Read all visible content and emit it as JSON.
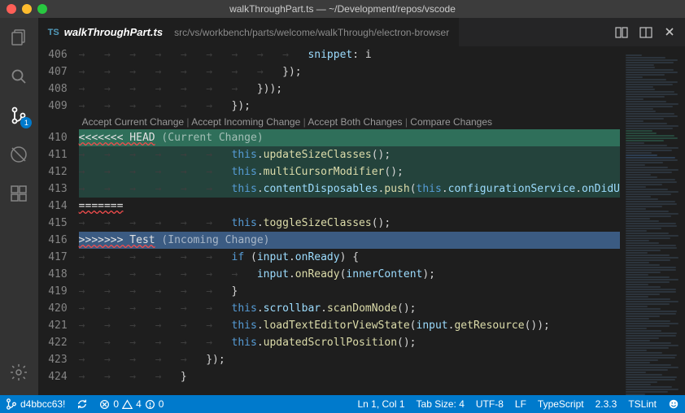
{
  "window": {
    "title": "walkThroughPart.ts — ~/Development/repos/vscode"
  },
  "tab": {
    "icon": "TS",
    "name": "walkThroughPart.ts",
    "breadcrumb": "src/vs/workbench/parts/welcome/walkThrough/electron-browser"
  },
  "scm_badge": "1",
  "codelens": {
    "accept_current": "Accept Current Change",
    "accept_incoming": "Accept Incoming Change",
    "accept_both": "Accept Both Changes",
    "compare": "Compare Changes",
    "sep": " | "
  },
  "lines": [
    {
      "n": "406",
      "kind": "plain",
      "indent": 9,
      "tokens": [
        [
          "prop",
          "snippet"
        ],
        [
          "punc",
          ": i"
        ]
      ]
    },
    {
      "n": "407",
      "kind": "plain",
      "indent": 8,
      "tokens": [
        [
          "punc",
          "});"
        ]
      ]
    },
    {
      "n": "408",
      "kind": "plain",
      "indent": 7,
      "tokens": [
        [
          "punc",
          "}));"
        ]
      ]
    },
    {
      "n": "409",
      "kind": "plain",
      "indent": 6,
      "tokens": [
        [
          "punc",
          "});"
        ]
      ]
    },
    {
      "n": "410",
      "kind": "current",
      "indent": 0,
      "tokens": [
        [
          "conflict",
          "<<<<<<< HEAD"
        ],
        [
          "hint",
          " (Current Change)"
        ]
      ]
    },
    {
      "n": "411",
      "kind": "current-body",
      "indent": 6,
      "tokens": [
        [
          "this",
          "this"
        ],
        [
          "punc",
          "."
        ],
        [
          "fn",
          "updateSizeClasses"
        ],
        [
          "punc",
          "();"
        ]
      ]
    },
    {
      "n": "412",
      "kind": "current-body",
      "indent": 6,
      "tokens": [
        [
          "this",
          "this"
        ],
        [
          "punc",
          "."
        ],
        [
          "fn",
          "multiCursorModifier"
        ],
        [
          "punc",
          "();"
        ]
      ]
    },
    {
      "n": "413",
      "kind": "current-body",
      "indent": 6,
      "tokens": [
        [
          "this",
          "this"
        ],
        [
          "punc",
          "."
        ],
        [
          "prop",
          "contentDisposables"
        ],
        [
          "punc",
          "."
        ],
        [
          "fn",
          "push"
        ],
        [
          "punc",
          "("
        ],
        [
          "this",
          "this"
        ],
        [
          "punc",
          "."
        ],
        [
          "prop",
          "configurationService"
        ],
        [
          "punc",
          "."
        ],
        [
          "prop",
          "onDidU"
        ]
      ]
    },
    {
      "n": "414",
      "kind": "sep",
      "indent": 0,
      "tokens": [
        [
          "conflict",
          "======="
        ]
      ]
    },
    {
      "n": "415",
      "kind": "plain",
      "indent": 6,
      "tokens": [
        [
          "this",
          "this"
        ],
        [
          "punc",
          "."
        ],
        [
          "fn",
          "toggleSizeClasses"
        ],
        [
          "punc",
          "();"
        ]
      ]
    },
    {
      "n": "416",
      "kind": "incoming",
      "indent": 0,
      "tokens": [
        [
          "conflict",
          ">>>>>>> Test"
        ],
        [
          "hint",
          " (Incoming Change)"
        ]
      ]
    },
    {
      "n": "417",
      "kind": "plain",
      "indent": 6,
      "tokens": [
        [
          "kw",
          "if"
        ],
        [
          "punc",
          " ("
        ],
        [
          "prop",
          "input"
        ],
        [
          "punc",
          "."
        ],
        [
          "prop",
          "onReady"
        ],
        [
          "punc",
          ") {"
        ]
      ]
    },
    {
      "n": "418",
      "kind": "plain",
      "indent": 7,
      "tokens": [
        [
          "prop",
          "input"
        ],
        [
          "punc",
          "."
        ],
        [
          "fn",
          "onReady"
        ],
        [
          "punc",
          "("
        ],
        [
          "param",
          "innerContent"
        ],
        [
          "punc",
          ");"
        ]
      ]
    },
    {
      "n": "419",
      "kind": "plain",
      "indent": 6,
      "tokens": [
        [
          "punc",
          "}"
        ]
      ]
    },
    {
      "n": "420",
      "kind": "plain",
      "indent": 6,
      "tokens": [
        [
          "this",
          "this"
        ],
        [
          "punc",
          "."
        ],
        [
          "prop",
          "scrollbar"
        ],
        [
          "punc",
          "."
        ],
        [
          "fn",
          "scanDomNode"
        ],
        [
          "punc",
          "();"
        ]
      ]
    },
    {
      "n": "421",
      "kind": "plain",
      "indent": 6,
      "tokens": [
        [
          "this",
          "this"
        ],
        [
          "punc",
          "."
        ],
        [
          "fn",
          "loadTextEditorViewState"
        ],
        [
          "punc",
          "("
        ],
        [
          "prop",
          "input"
        ],
        [
          "punc",
          "."
        ],
        [
          "fn",
          "getResource"
        ],
        [
          "punc",
          "());"
        ]
      ]
    },
    {
      "n": "422",
      "kind": "plain",
      "indent": 6,
      "tokens": [
        [
          "this",
          "this"
        ],
        [
          "punc",
          "."
        ],
        [
          "fn",
          "updatedScrollPosition"
        ],
        [
          "punc",
          "();"
        ]
      ]
    },
    {
      "n": "423",
      "kind": "plain",
      "indent": 5,
      "tokens": [
        [
          "punc",
          "});"
        ]
      ]
    },
    {
      "n": "424",
      "kind": "plain",
      "indent": 4,
      "tokens": [
        [
          "punc",
          "}"
        ]
      ]
    }
  ],
  "statusbar": {
    "branch": "d4bbcc63!",
    "errors": "0",
    "warnings": "4",
    "infos": "0",
    "cursor": "Ln 1, Col 1",
    "tabsize": "Tab Size: 4",
    "encoding": "UTF-8",
    "eol": "LF",
    "lang": "TypeScript",
    "tsver": "2.3.3",
    "linter": "TSLint"
  }
}
